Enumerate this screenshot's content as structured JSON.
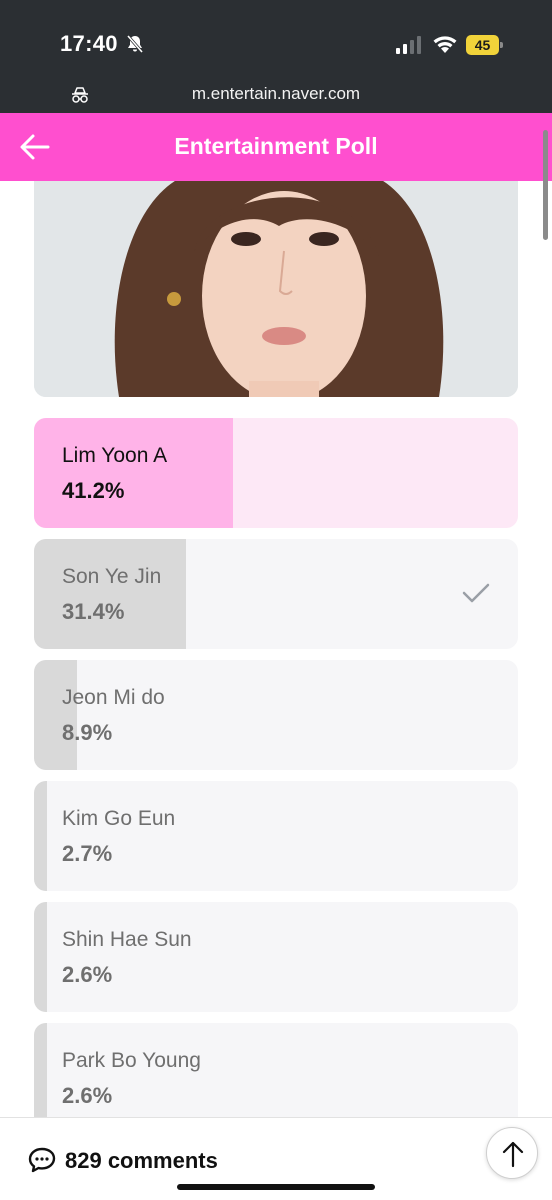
{
  "status_bar": {
    "time": "17:40",
    "battery": "45",
    "icons": [
      "bell-off-icon",
      "signal-icon",
      "wifi-icon",
      "battery-icon"
    ]
  },
  "browser": {
    "url": "m.entertain.naver.com",
    "icons": [
      "incognito-icon"
    ]
  },
  "header": {
    "title": "Entertainment Poll",
    "back_icon": "back-arrow-icon",
    "accent_color": "#ff4fcf"
  },
  "poll": {
    "options": [
      {
        "name": "Lim Yoon A",
        "percent_label": "41.2%",
        "percent": 41.2,
        "leader": true
      },
      {
        "name": "Son Ye Jin",
        "percent_label": "31.4%",
        "percent": 31.4,
        "checked": true
      },
      {
        "name": "Jeon Mi do",
        "percent_label": "8.9%",
        "percent": 8.9
      },
      {
        "name": "Kim Go Eun",
        "percent_label": "2.7%",
        "percent": 2.7
      },
      {
        "name": "Shin Hae Sun",
        "percent_label": "2.6%",
        "percent": 2.6
      },
      {
        "name": "Park Bo Young",
        "percent_label": "2.6%",
        "percent": 2.6
      }
    ]
  },
  "footer": {
    "comments_label": "829 comments",
    "icons": [
      "comment-icon",
      "scroll-to-top-icon"
    ]
  }
}
